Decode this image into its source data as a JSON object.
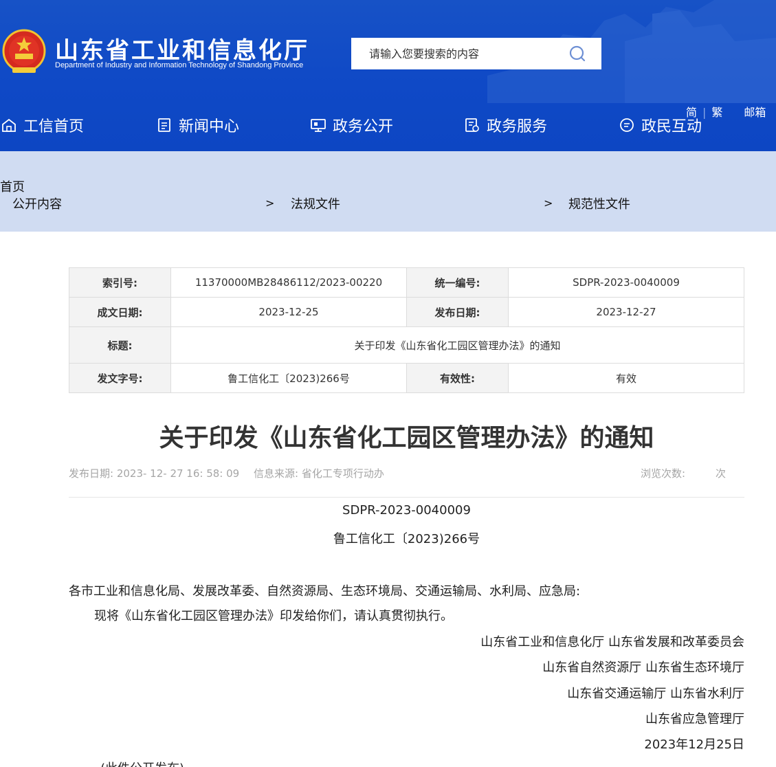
{
  "header": {
    "site_title": "山东省工业和信息化厅",
    "site_subtitle": "Department of Industry and Information Technology of Shandong Province",
    "search_placeholder": "请输入您要搜索的内容",
    "colors": {
      "header_blue": "#0f49c6",
      "breadcrumb_bg": "#d0dcf2"
    }
  },
  "top_links": {
    "simplified": "简",
    "separator": "|",
    "traditional": "繁",
    "mail": "邮箱"
  },
  "nav": [
    {
      "label": "工信首页",
      "icon": "home-icon"
    },
    {
      "label": "新闻中心",
      "icon": "document-icon"
    },
    {
      "label": "政务公开",
      "icon": "monitor-icon"
    },
    {
      "label": "政务服务",
      "icon": "service-icon"
    },
    {
      "label": "政民互动",
      "icon": "chat-icon"
    }
  ],
  "breadcrumb": {
    "items": [
      "首页",
      "公开内容",
      "法规文件",
      "规范性文件"
    ],
    "separator": ">"
  },
  "info": {
    "index_label": "索引号:",
    "index_value": "11370000MB28486112/2023-00220",
    "code_label": "统一编号:",
    "code_value": "SDPR-2023-0040009",
    "made_date_label": "成文日期:",
    "made_date_value": "2023-12-25",
    "pub_date_label": "发布日期:",
    "pub_date_value": "2023-12-27",
    "title_label": "标题:",
    "title_value": "关于印发《山东省化工园区管理办法》的通知",
    "doc_no_label": "发文字号:",
    "doc_no_value": "鲁工信化工〔2023)266号",
    "validity_label": "有效性:",
    "validity_value": "有效"
  },
  "article": {
    "title": "关于印发《山东省化工园区管理办法》的通知",
    "publish_meta": "发布日期: 2023- 12- 27 16: 58: 09",
    "source_meta": "信息来源: 省化工专项行动办",
    "views_label": "浏览次数:",
    "views_unit": "次",
    "doc_code": "SDPR-2023-0040009",
    "doc_number": "鲁工信化工〔2023)266号",
    "addressee": "各市工业和信息化局、发展改革委、自然资源局、生态环境局、交通运输局、水利局、应急局:",
    "body": "现将《山东省化工园区管理办法》印发给你们，请认真贯彻执行。",
    "signatures": [
      "山东省工业和信息化厅 山东省发展和改革委员会",
      "山东省自然资源厅 山东省生态环境厅",
      "山东省交通运输厅 山东省水利厅",
      "山东省应急管理厅"
    ],
    "date": "2023年12月25日",
    "footnote": "(此件公开发布)"
  }
}
